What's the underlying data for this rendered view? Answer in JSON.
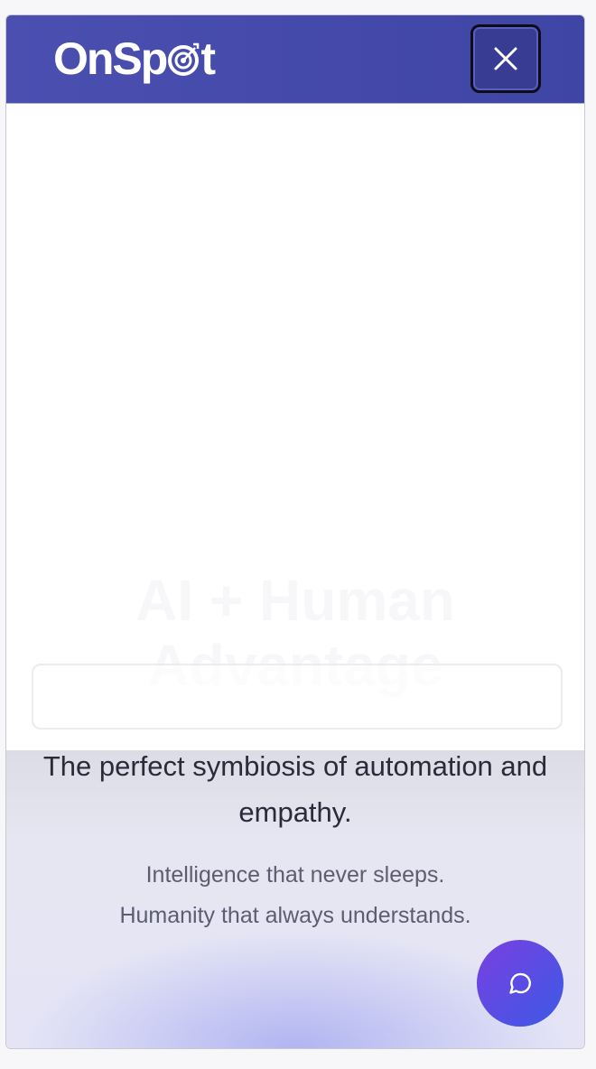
{
  "header": {
    "logo_text_left": "OnSp",
    "logo_text_right": "t",
    "logo_icon": "target-icon",
    "close_icon": "close-icon"
  },
  "hero": {
    "title_line1": "AI + Human",
    "title_line2": "Advantage"
  },
  "search": {
    "value": ""
  },
  "content": {
    "tagline": "The perfect symbiosis of automation and empathy.",
    "sub_line1": "Intelligence that never sleeps.",
    "sub_line2": "Humanity that always understands."
  },
  "chat": {
    "icon": "chat-bubble-icon"
  },
  "colors": {
    "header_bg": "#4148a8",
    "fab_start": "#7a3fe0",
    "fab_end": "#3c5ae6"
  }
}
